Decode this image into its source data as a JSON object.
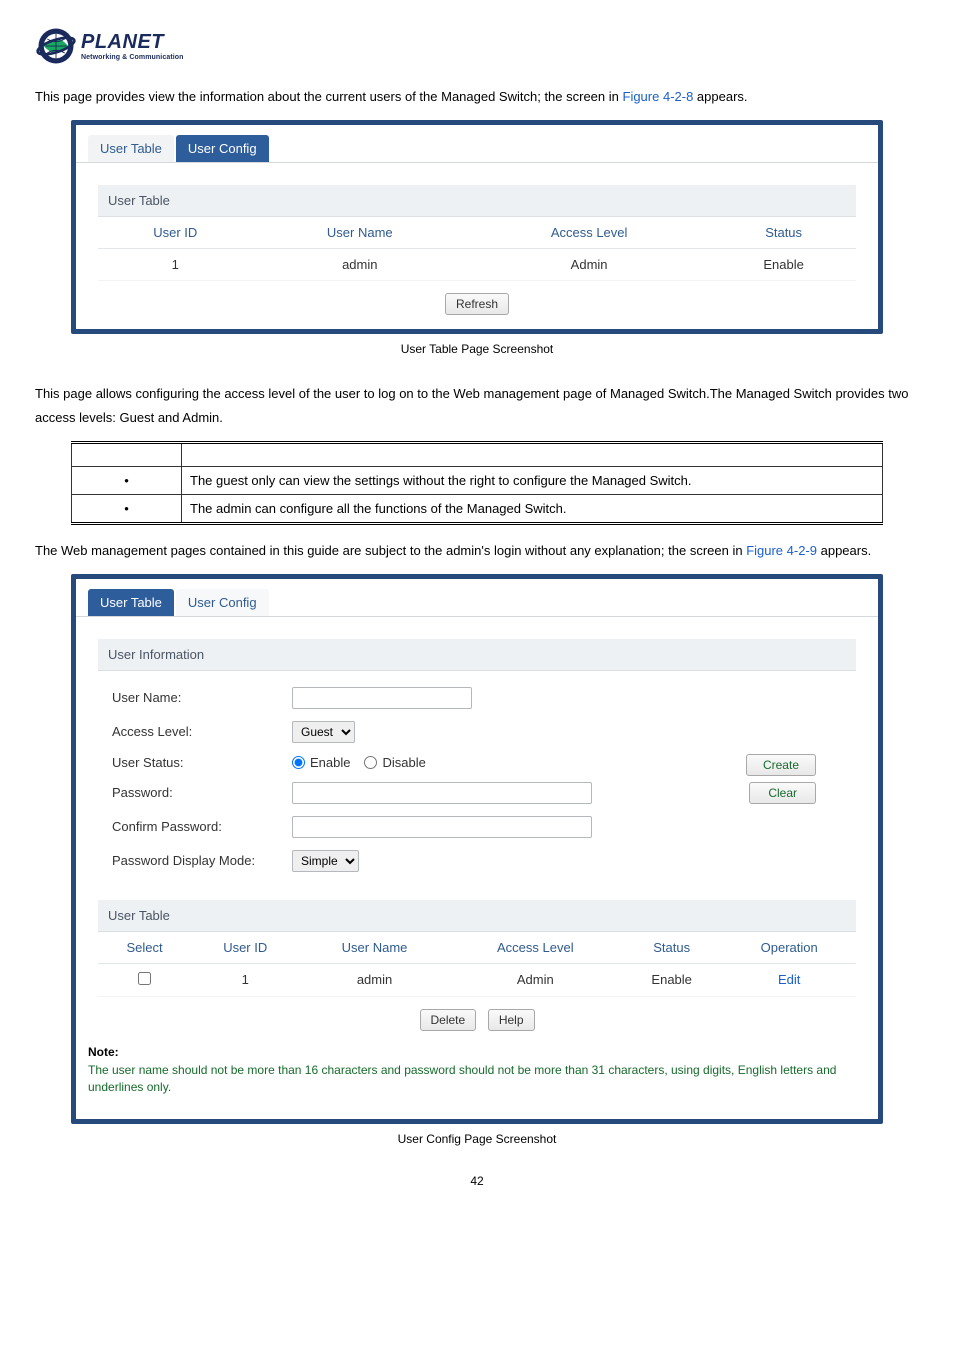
{
  "logo": {
    "name": "PLANET",
    "tagline": "Networking & Communication"
  },
  "intro1_a": "This page provides view the information about the current users of the Managed Switch; the screen in ",
  "intro1_link": "Figure 4-2-8",
  "intro1_b": " appears.",
  "fig1_caption": "User Table Page Screenshot",
  "panel1": {
    "tabs": {
      "table": "User Table",
      "config": "User Config"
    },
    "section": "User Table",
    "headers": {
      "id": "User ID",
      "name": "User Name",
      "level": "Access Level",
      "status": "Status"
    },
    "row": {
      "id": "1",
      "name": "admin",
      "level": "Admin",
      "status": "Enable"
    },
    "refresh": "Refresh"
  },
  "intro2": "This page allows configuring the access level of the user to log on to the Web management page of Managed Switch.The Managed Switch provides two access levels: Guest and Admin.",
  "levels": {
    "guest": "The guest only can view the settings without the right to configure the Managed Switch.",
    "admin": "The admin can configure all the functions of the Managed Switch."
  },
  "intro3_a": "The Web management pages contained in this guide are subject to the admin's login without any explanation; the screen in ",
  "intro3_link": "Figure 4-2-9",
  "intro3_b": " appears.",
  "panel2": {
    "tabs": {
      "table": "User Table",
      "config": "User Config"
    },
    "section_info": "User Information",
    "labels": {
      "username": "User Name:",
      "access": "Access Level:",
      "status": "User Status:",
      "password": "Password:",
      "confirm": "Confirm Password:",
      "pdm": "Password Display Mode:"
    },
    "access_options": [
      "Guest"
    ],
    "status_enable": "Enable",
    "status_disable": "Disable",
    "pdm_options": [
      "Simple"
    ],
    "create": "Create",
    "clear": "Clear",
    "section_table": "User Table",
    "headers": {
      "select": "Select",
      "id": "User ID",
      "name": "User Name",
      "level": "Access Level",
      "status": "Status",
      "op": "Operation"
    },
    "row": {
      "id": "1",
      "name": "admin",
      "level": "Admin",
      "status": "Enable",
      "op": "Edit"
    },
    "delete": "Delete",
    "help": "Help",
    "note_title": "Note:",
    "note_body": "The user name should not be more than 16 characters and password should not be more than 31 characters, using digits, English letters and underlines only."
  },
  "fig2_caption": "User Config Page Screenshot",
  "page_number": "42"
}
